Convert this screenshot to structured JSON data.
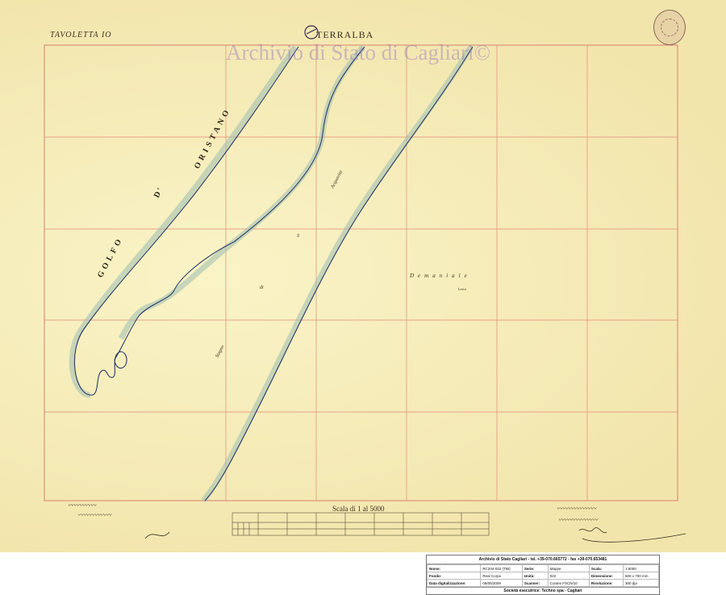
{
  "map": {
    "tavoletta": "TAVOLETTA IO",
    "town": "TERRALBA",
    "watermark": "Archivio di Stato di Cagliari©",
    "gulf_label": [
      "GOLFO",
      "D'",
      "ORISTANO"
    ],
    "scale_label": "Scala di 1 al 5000",
    "place_labels": [
      "Stagno",
      "di",
      "S",
      "Demaniale",
      "Acquavita",
      "Lestos"
    ]
  },
  "footer": {
    "title": "Archivio di Stato Cagliari - tel. +39-070.665772 - fax +39-070.653481",
    "rows": [
      [
        "Nome:",
        "RC204-022 (TIB)",
        "Serie:",
        "Mappe",
        "Scala:",
        "1:5000"
      ],
      [
        "Fondo:",
        "Real Corpo",
        "Unità:",
        "022",
        "Dimensione:",
        "500 x 700 mm"
      ],
      [
        "Data digitalizzazione:",
        "05/05/2009",
        "Scanner:",
        "Contex FSCN/10",
        "Risoluzione:",
        "300 dpi"
      ]
    ],
    "company": "Società esecutrice: Techno spa - Cagliari"
  },
  "colors": {
    "paper": "#f6edb6",
    "grid": "#e28a7a",
    "coast": "#2c3a6a",
    "shade": "#9fbfb0"
  }
}
